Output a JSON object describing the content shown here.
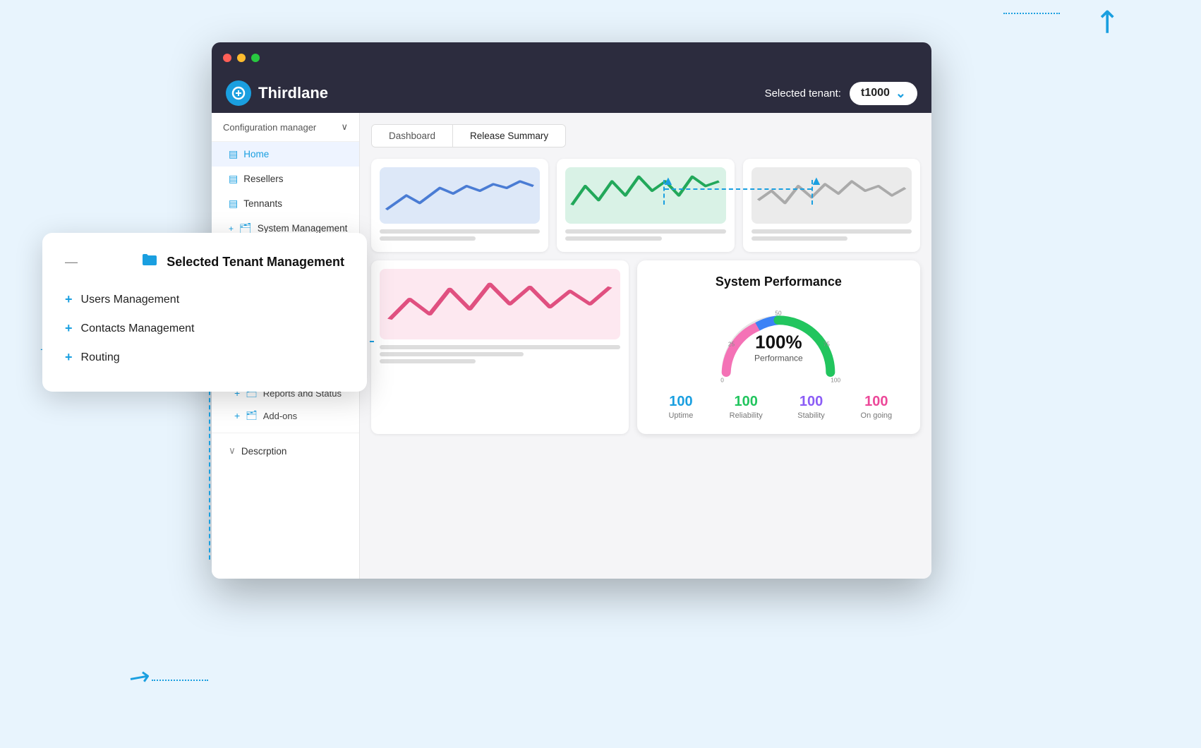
{
  "app": {
    "name": "Thirdlane",
    "logo_symbol": "(((",
    "selected_tenant_label": "Selected tenant:",
    "tenant_value": "t1000"
  },
  "header": {
    "traffic_lights": [
      "red",
      "yellow",
      "green"
    ]
  },
  "nav": {
    "config_manager_label": "Configuration manager",
    "items": [
      {
        "id": "home",
        "label": "Home",
        "active": true
      },
      {
        "id": "resellers",
        "label": "Resellers",
        "active": false
      },
      {
        "id": "tennants",
        "label": "Tennants",
        "active": false
      },
      {
        "id": "system-management",
        "label": "System Management",
        "active": false,
        "expandable": true
      }
    ],
    "bottom_items": [
      {
        "id": "reports",
        "label": "Reports and Status",
        "expandable": true
      },
      {
        "id": "addons",
        "label": "Add-ons",
        "expandable": true
      }
    ],
    "description_label": "Descrption"
  },
  "tabs": [
    {
      "id": "dashboard",
      "label": "Dashboard",
      "active": false
    },
    {
      "id": "release-summary",
      "label": "Release Summary",
      "active": true
    }
  ],
  "cards": [
    {
      "id": "card-blue",
      "color_class": "card-blue",
      "line_color": "#4a7cd4"
    },
    {
      "id": "card-green",
      "color_class": "card-green",
      "line_color": "#22a85a"
    },
    {
      "id": "card-gray",
      "color_class": "card-gray",
      "line_color": "#aaaaaa"
    },
    {
      "id": "card-pink",
      "color_class": "card-pink",
      "line_color": "#e05080"
    }
  ],
  "performance": {
    "title": "System Performance",
    "percent": "100%",
    "label": "Performance",
    "gauge_value": 100,
    "tick_labels": {
      "0": "0",
      "25": "25",
      "50": "50",
      "75": "75",
      "100": "100"
    },
    "stats": [
      {
        "id": "uptime",
        "value": "100",
        "label": "Uptime",
        "color_class": "stat-blue"
      },
      {
        "id": "reliability",
        "value": "100",
        "label": "Reliability",
        "color_class": "stat-green"
      },
      {
        "id": "stability",
        "value": "100",
        "label": "Stability",
        "color_class": "stat-purple"
      },
      {
        "id": "ongoing",
        "value": "100",
        "label": "On going",
        "color_class": "stat-pink"
      }
    ]
  },
  "floating_panel": {
    "title": "Selected Tenant Management",
    "items": [
      {
        "id": "users-mgmt",
        "label": "Users Management"
      },
      {
        "id": "contacts-mgmt",
        "label": "Contacts Management"
      },
      {
        "id": "routing",
        "label": "Routing"
      }
    ]
  }
}
